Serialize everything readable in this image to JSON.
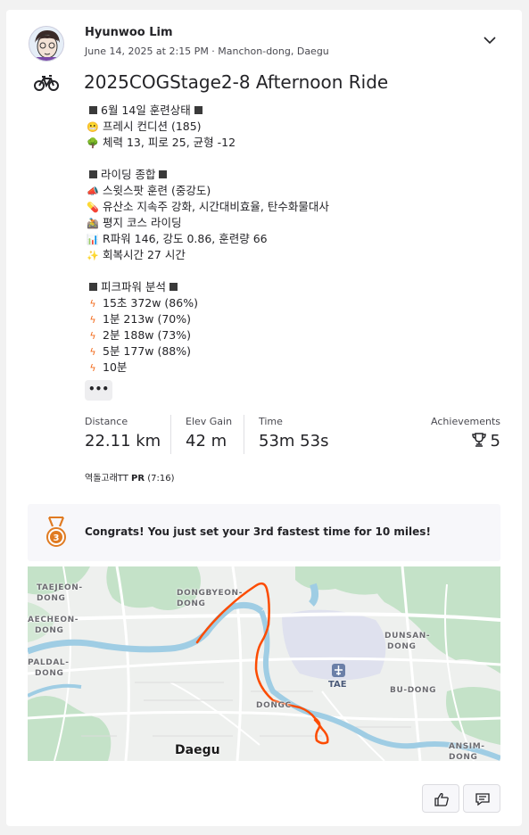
{
  "activity": {
    "athlete_name": "Hyunwoo Lim",
    "meta": "June 14, 2025 at 2:15 PM · Manchon-dong, Daegu",
    "title": "2025COGStage2-8 Afternoon Ride",
    "activity_type_icon": "bike-icon",
    "menu_icon": "chevron-down-icon"
  },
  "description": {
    "section1_header": "6월 14일 훈련상태",
    "line_freshness": "프레시 컨디션 (185)",
    "line_fitness": "체력 13, 피로 25, 균형 -12",
    "section2_header": "라이딩 종합",
    "line_sweetspot": "스윗스팟 훈련 (중강도)",
    "line_aerobic": "유산소 지속주 강화, 시간대비효율, 탄수화물대사",
    "line_flat": "평지 코스 라이딩",
    "line_power": "R파워 146, 강도 0.86, 훈련량 66",
    "line_recovery": "회복시간 27 시간",
    "section3_header": "피크파워 분석",
    "peak_lines": [
      "15초 372w (86%)",
      "1분 213w (70%)",
      "2분 188w (73%)",
      "5분 177w (88%)",
      "10분"
    ],
    "more_label": "•••"
  },
  "stats": {
    "distance_label": "Distance",
    "distance_value": "22.11 km",
    "elev_label": "Elev Gain",
    "elev_value": "42 m",
    "time_label": "Time",
    "time_value": "53m 53s",
    "achievements_label": "Achievements",
    "achievements_value": "5"
  },
  "segment": {
    "name": "역돌고래TT",
    "pr_label": "PR",
    "pr_time": "(7:16)"
  },
  "congrats": {
    "medal_rank": "3",
    "text": "Congrats! You just set your 3rd fastest time for 10 miles!"
  },
  "map": {
    "labels": {
      "taejeon1": "TAEJEON-",
      "taejeon2": "DONG",
      "aecheon1": "AECHEON-",
      "aecheon2": "DONG",
      "palda1": "PALDAL-",
      "palda2": "DONG",
      "dongbyeon1": "DONGBYEON-",
      "dongbyeon2": "DONG",
      "dunsan1": "DUNSAN-",
      "dunsan2": "DONG",
      "budong": "BU-DONG",
      "dongc": "DONGC",
      "ansim1": "ANSIM-",
      "ansim2": "DONG",
      "tae": "TAE",
      "city": "Daegu"
    },
    "route_color": "#fc4c02",
    "water_color": "#9fcde4",
    "park_color": "#bfe0c4"
  },
  "actions": {
    "kudos_icon": "thumbs-up-icon",
    "comment_icon": "comment-icon"
  }
}
